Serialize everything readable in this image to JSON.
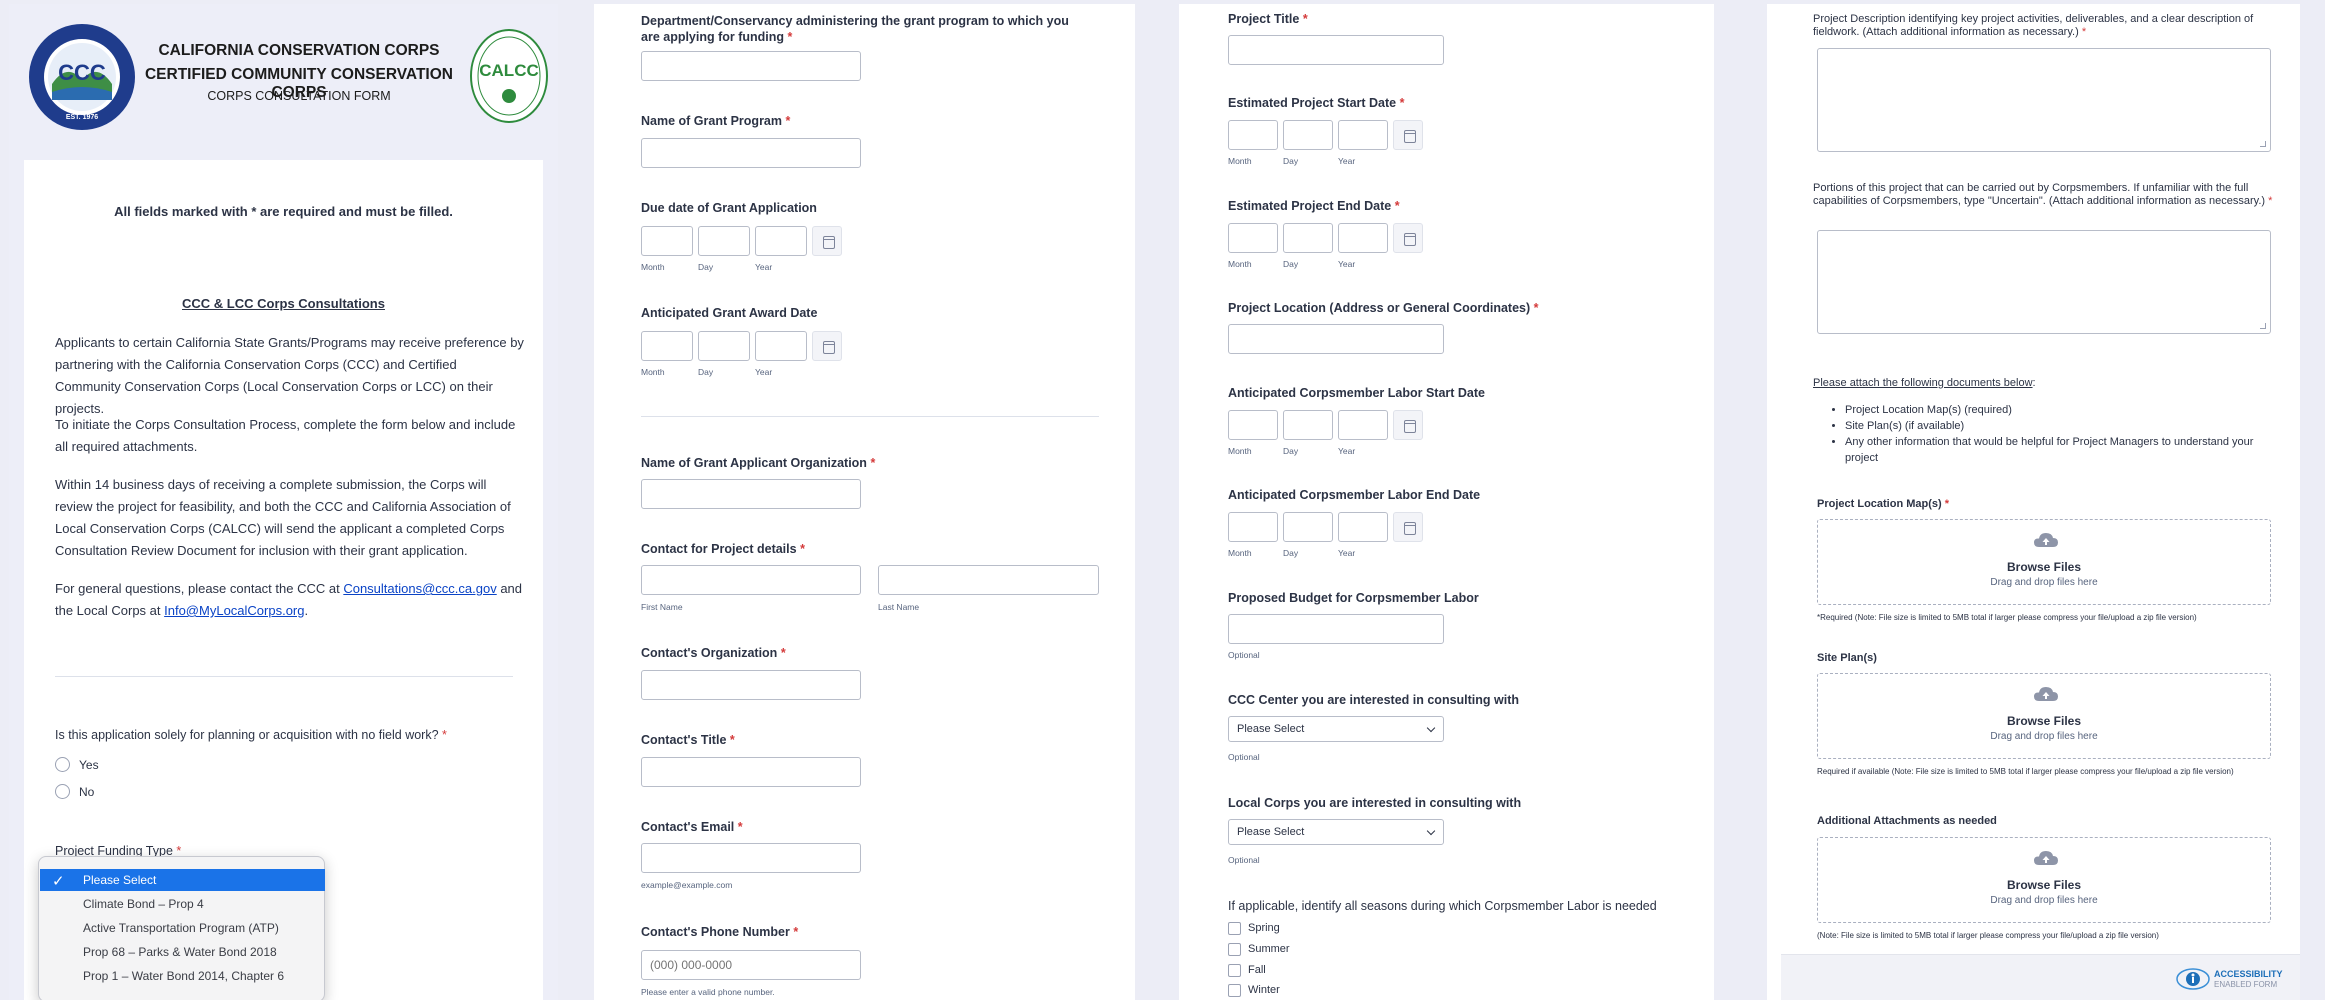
{
  "header": {
    "title_line1": "CALIFORNIA CONSERVATION CORPS",
    "title_line2": "CERTIFIED COMMUNITY CONSERVATION CORPS",
    "subtitle": "CORPS CONSULTATION FORM",
    "left_logo": {
      "text": "CCC",
      "ring_text": "CALIFORNIA CONSERVATION CORPS",
      "est": "EST. 1976",
      "color": "#1f3c8c"
    },
    "right_logo": {
      "text": "CALCC",
      "color": "#2e8b3d"
    }
  },
  "intro": {
    "required_note": "All fields marked with * are required and must be filled.",
    "section_title": "CCC & LCC Corps Consultations",
    "p1": "Applicants to certain California State Grants/Programs may receive preference by partnering with the California Conservation Corps (CCC) and Certified Community Conservation Corps (Local Conservation Corps or LCC) on their projects.",
    "p2": "To initiate the Corps Consultation Process, complete the form below and include all required attachments.",
    "p3": "Within 14 business days of receiving a complete submission, the Corps will review the project for feasibility, and both the CCC and California Association of Local Conservation Corps (CALCC) will send the applicant a completed Corps Consultation Review Document for inclusion with their grant application.",
    "p4_a": "For general questions, please contact the CCC at ",
    "p4_link1": "Consultations@ccc.ca.gov",
    "p4_b": " and the Local Corps at ",
    "p4_link2": "Info@MyLocalCorps.org",
    "p4_c": "."
  },
  "q_planning": {
    "label": "Is this application solely for planning or acquisition with no field work?",
    "required": "*",
    "options": [
      "Yes",
      "No"
    ]
  },
  "funding": {
    "label": "Project Funding Type",
    "required": "*",
    "options": [
      "Please Select",
      "Climate Bond – Prop 4",
      "Active Transportation Program (ATP)",
      "Prop 68 – Parks & Water Bond 2018",
      "Prop 1 – Water Bond 2014, Chapter 6"
    ],
    "selected": "Please Select"
  },
  "col2": {
    "department_label": "Department/Conservancy administering the grant program to which you are applying for funding",
    "grant_program_label": "Name of Grant Program",
    "due_date_label": "Due date of Grant Application",
    "award_date_label": "Anticipated Grant Award Date",
    "date_sub": {
      "month": "Month",
      "day": "Day",
      "year": "Year"
    },
    "applicant_org_label": "Name of Grant Applicant Organization",
    "contact_label": "Contact for Project details",
    "first_name": "First Name",
    "last_name": "Last Name",
    "contact_org_label": "Contact's Organization",
    "contact_title_label": "Contact's Title",
    "contact_email_label": "Contact's Email",
    "email_sub": "example@example.com",
    "phone_label": "Contact's Phone Number",
    "phone_placeholder": "(000) 000-0000",
    "phone_sub": "Please enter a valid phone number.",
    "req": "*"
  },
  "col3": {
    "title_label": "Project Title",
    "start_label": "Estimated Project Start Date",
    "end_label": "Estimated Project End Date",
    "location_label": "Project Location (Address or General Coordinates)",
    "labor_start_label": "Anticipated Corpsmember Labor Start Date",
    "labor_end_label": "Anticipated Corpsmember Labor End Date",
    "budget_label": "Proposed Budget for Corpsmember Labor",
    "optional": "Optional",
    "ccc_center_label": "CCC Center you are interested in consulting with",
    "local_corps_label": "Local Corps you are interested in consulting with",
    "select_placeholder": "Please Select",
    "seasons_label": "If applicable, identify all seasons during which Corpsmember Labor is needed",
    "seasons": [
      "Spring",
      "Summer",
      "Fall",
      "Winter"
    ],
    "req": "*"
  },
  "col4": {
    "desc_label": "Project Description identifying key project activities, deliverables, and a clear description of fieldwork. (Attach additional information as necessary.)",
    "portions_label": "Portions of this project that can be carried out by Corpsmembers. If unfamiliar with the full capabilities of Corpsmembers, type \"Uncertain\". (Attach additional information as necessary.)",
    "attach_heading": "Please attach the following documents below",
    "attach_colon": ":",
    "docs": [
      "Project Location Map(s) (required)",
      "Site Plan(s) (if available)",
      "Any other information that would be helpful for Project Managers to understand your project"
    ],
    "map_label": "Project Location Map(s)",
    "site_label": "Site Plan(s)",
    "additional_label": "Additional Attachments as needed",
    "browse": "Browse Files",
    "drag": "Drag and drop files here",
    "map_note": "*Required (Note: File size is limited to 5MB total if larger please compress your file/upload a zip file version)",
    "site_note": "Required if available (Note: File size is limited to 5MB total if larger please compress your file/upload a zip file version)",
    "additional_note": "(Note: File size is limited to 5MB total if larger please compress your file/upload a zip file version)",
    "badge_line1": "ACCESSIBILITY",
    "badge_line2": "ENABLED FORM",
    "req": "*"
  }
}
